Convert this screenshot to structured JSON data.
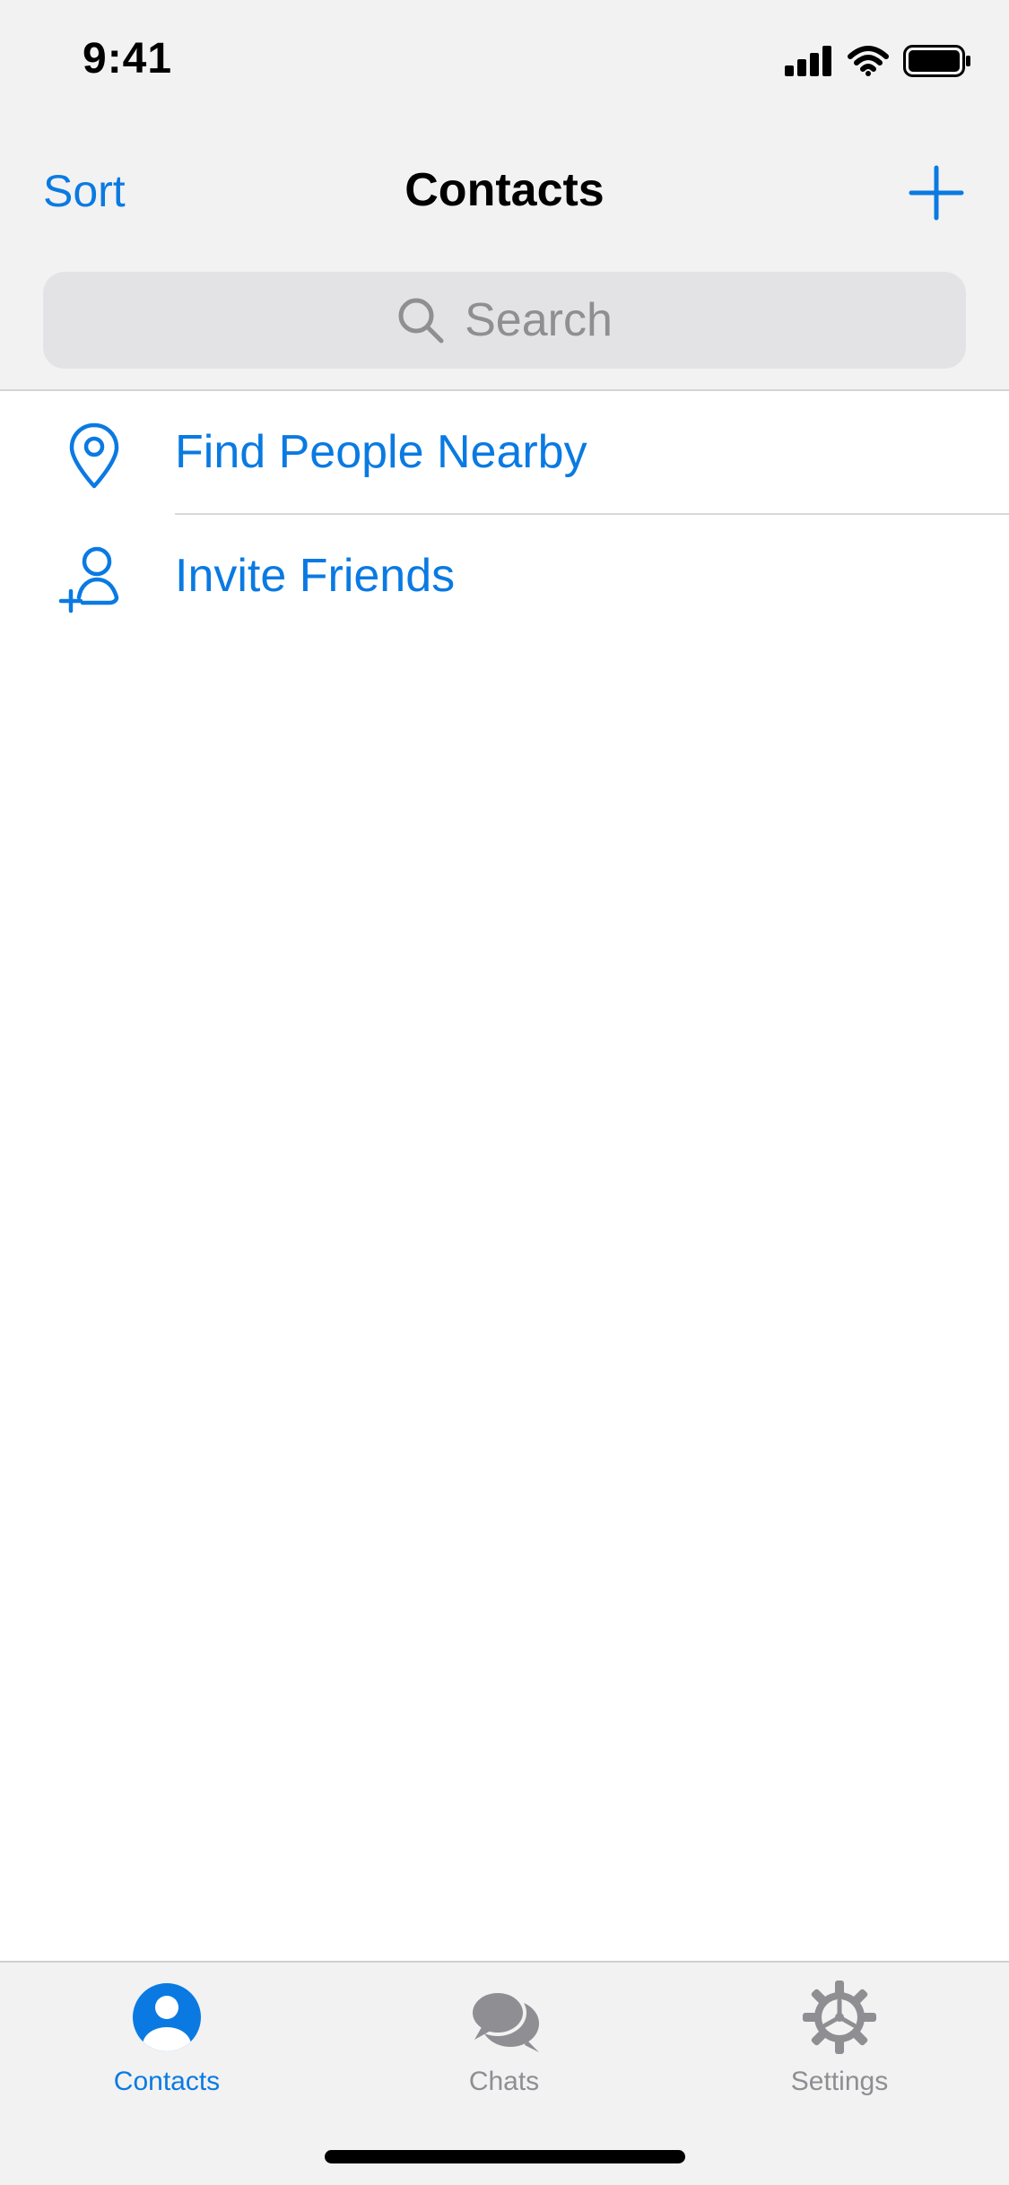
{
  "status_bar": {
    "time": "9:41",
    "icons": [
      "cellular-signal-icon",
      "wifi-icon",
      "battery-icon"
    ]
  },
  "nav": {
    "left_label": "Sort",
    "title": "Contacts",
    "right_icon": "plus-icon"
  },
  "search": {
    "placeholder": "Search",
    "icon": "search-icon"
  },
  "list": {
    "items": [
      {
        "label": "Find People Nearby",
        "icon": "location-pin-icon"
      },
      {
        "label": "Invite Friends",
        "icon": "add-person-icon"
      }
    ]
  },
  "tabbar": {
    "tabs": [
      {
        "label": "Contacts",
        "icon": "person-circle-icon",
        "active": true
      },
      {
        "label": "Chats",
        "icon": "chat-bubbles-icon",
        "active": false
      },
      {
        "label": "Settings",
        "icon": "gear-icon",
        "active": false
      }
    ]
  },
  "colors": {
    "accent": "#0a7ae2",
    "inactive": "#8e8e93",
    "bar_background": "#f2f2f2"
  }
}
